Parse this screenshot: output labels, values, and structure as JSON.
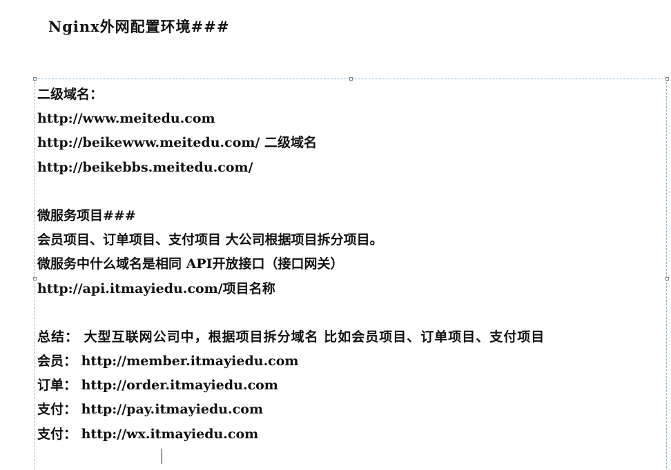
{
  "document": {
    "title": "Nginx外网配置环境###"
  },
  "text_block": {
    "lines": [
      "二级域名：",
      "http://www.meitedu.com",
      "http://beikewww.meitedu.com/  二级域名",
      "http://beikebbs.meitedu.com/",
      "",
      "微服务项目###",
      "会员项目、订单项目、支付项目 大公司根据项目拆分项目。",
      "微服务中什么域名是相同 API开放接口（接口网关）",
      "http://api.itmayiedu.com/项目名称",
      "",
      "总结： 大型互联网公司中，根据项目拆分域名 比如会员项目、订单项目、支付项目",
      "会员： http://member.itmayiedu.com",
      "订单： http://order.itmayiedu.com",
      "支付： http://pay.itmayiedu.com",
      "支付： http://wx.itmayiedu.com"
    ]
  }
}
